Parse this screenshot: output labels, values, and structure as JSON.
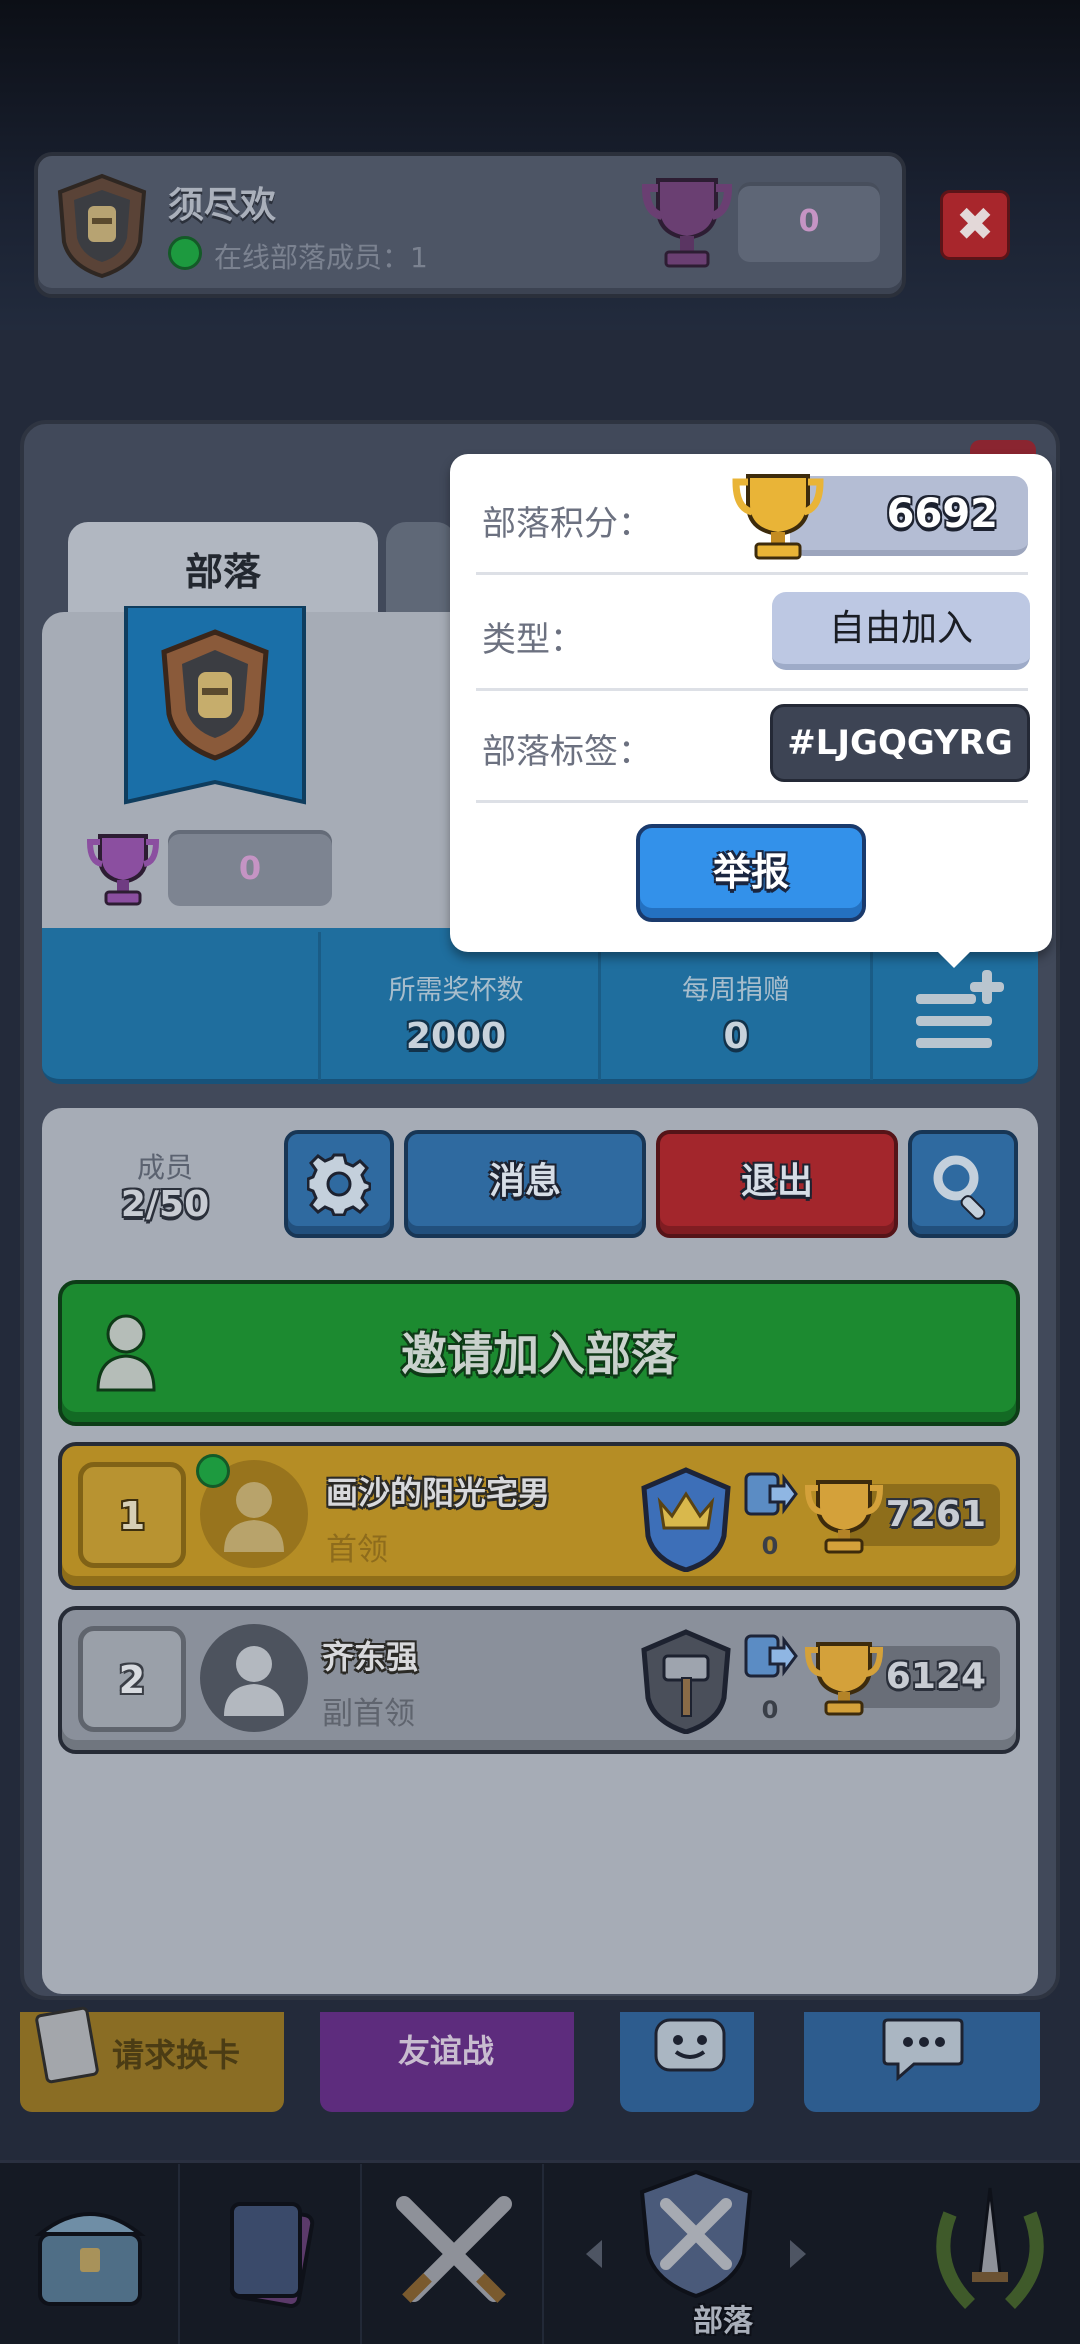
{
  "header": {
    "clan_name": "须尽欢",
    "online_text": "在线部落成员：1",
    "trophies": "0",
    "close_label": "✖"
  },
  "tabs": {
    "clan_label": "部落"
  },
  "clan": {
    "trophies": "0",
    "stats": [
      {
        "label": "所需奖杯数",
        "value": "2000"
      },
      {
        "label": "每周捐赠",
        "value": "0"
      }
    ]
  },
  "members": {
    "label": "成员",
    "count": "2/50",
    "message_label": "消息",
    "leave_label": "退出",
    "invite_label": "邀请加入部落",
    "list": [
      {
        "rank": "1",
        "name": "画沙的阳光宅男",
        "role": "首领",
        "donations": "0",
        "trophies": "7261",
        "online": true
      },
      {
        "rank": "2",
        "name": "齐东强",
        "role": "副首领",
        "donations": "0",
        "trophies": "6124",
        "online": false
      }
    ]
  },
  "bottom_actions": {
    "request_card": "请求换卡",
    "friendly_battle": "友谊战"
  },
  "nav": {
    "active_label": "部落"
  },
  "popup": {
    "score_label": "部落积分：",
    "score_value": "6692",
    "type_label": "类型：",
    "type_value": "自由加入",
    "tag_label": "部落标签：",
    "tag_value": "#LJGQGYRG",
    "report_label": "举报"
  },
  "colors": {
    "accent_blue": "#3391ea",
    "invite_green": "#1c8a30",
    "leave_red": "#a3262c",
    "leader_gold": "#b58d25"
  }
}
